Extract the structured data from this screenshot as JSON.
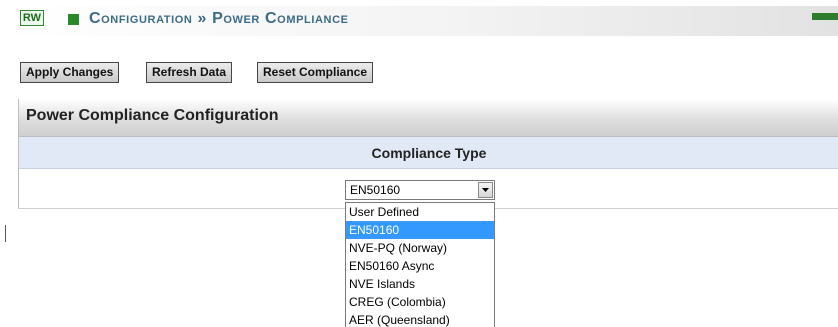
{
  "header": {
    "access_badge": "RW",
    "title": "Configuration » Power Compliance",
    "status_color": "#2e7d2e"
  },
  "toolbar": {
    "apply_label": "Apply Changes",
    "refresh_label": "Refresh Data",
    "reset_label": "Reset Compliance"
  },
  "panel": {
    "title": "Power Compliance Configuration",
    "column_header": "Compliance Type"
  },
  "compliance_select": {
    "selected": "EN50160",
    "options": [
      "User Defined",
      "EN50160",
      "NVE-PQ (Norway)",
      "EN50160 Async",
      "NVE Islands",
      "CREG (Colombia)",
      "AER (Queensland)"
    ],
    "highlighted_index": 1,
    "highlight_color": "#3399ff"
  }
}
